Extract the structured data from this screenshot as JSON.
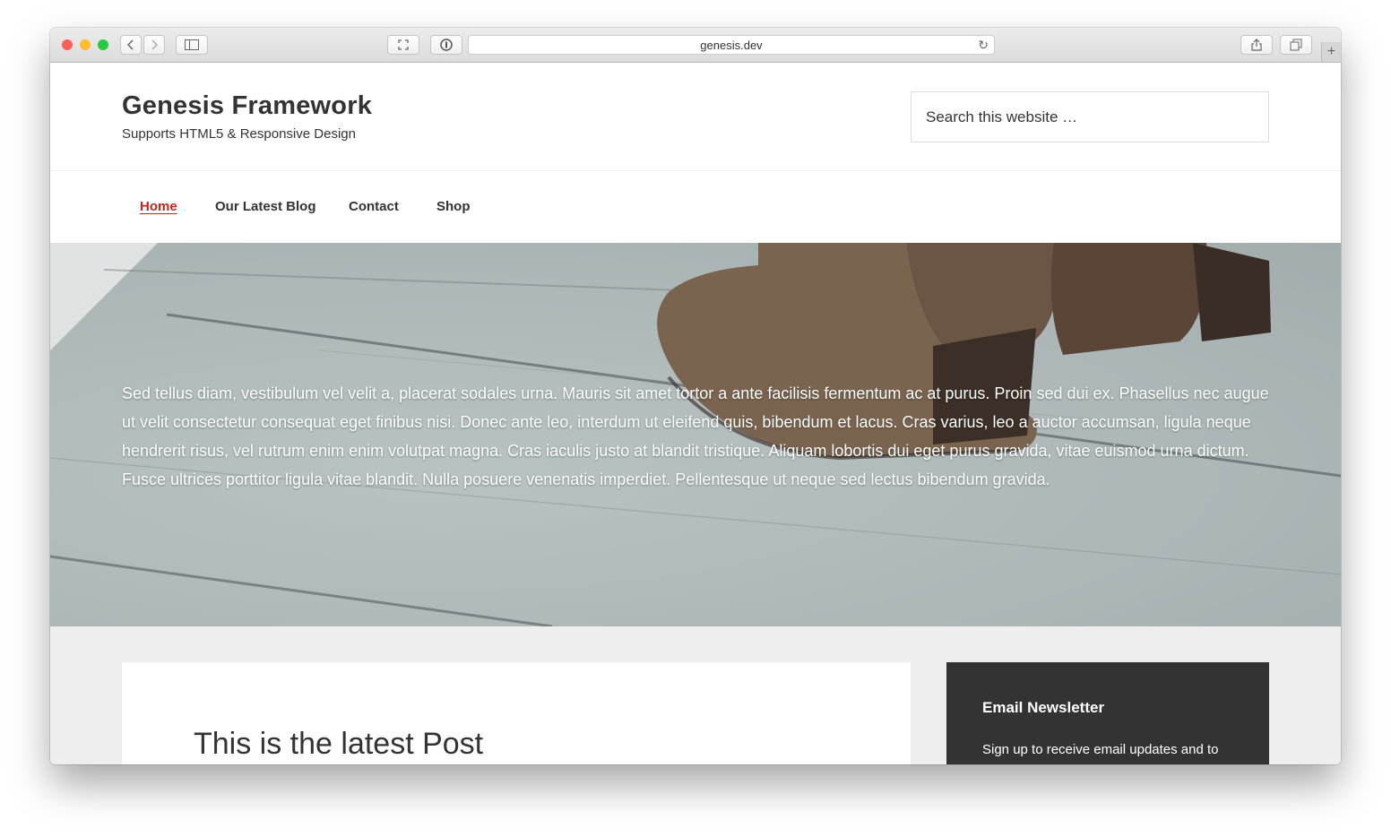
{
  "browser": {
    "url": "genesis.dev",
    "colors": {
      "close": "#ff5f57",
      "minimize": "#febc2e",
      "zoom": "#28c840"
    },
    "icons": [
      "back-icon",
      "forward-icon",
      "sidebar-icon",
      "reader-icon",
      "password-icon",
      "reload-icon",
      "share-icon",
      "tabs-icon",
      "plus-icon"
    ]
  },
  "site": {
    "title": "Genesis Framework",
    "description": "Supports HTML5 & Responsive Design",
    "search_placeholder": "Search this website …"
  },
  "nav": {
    "items": [
      {
        "label": "Home",
        "active": true
      },
      {
        "label": "Our Latest Blog",
        "active": false
      },
      {
        "label": "Contact",
        "active": false
      },
      {
        "label": "Shop",
        "active": false
      }
    ],
    "active_color": "#c3251d"
  },
  "hero": {
    "text": "Sed tellus diam, vestibulum vel velit a, placerat sodales urna. Mauris sit amet tortor a ante facilisis fermentum ac at purus. Proin sed dui ex. Phasellus nec augue ut velit consectetur consequat eget finibus nisi. Donec ante leo, interdum ut eleifend quis, bibendum et lacus. Cras varius, leo a auctor accumsan, ligula neque hendrerit risus, vel rutrum enim enim volutpat magna. Cras iaculis justo at blandit tristique. Aliquam lobortis dui eget purus gravida, vitae euismod urna dictum. Fusce ultrices porttitor ligula vitae blandit. Nulla posuere venenatis imperdiet. Pellentesque ut neque sed lectus bibendum gravida."
  },
  "post": {
    "title": "This is the latest Post"
  },
  "sidebar": {
    "widget_title": "Email Newsletter",
    "widget_text": "Sign up to receive email updates and to"
  }
}
